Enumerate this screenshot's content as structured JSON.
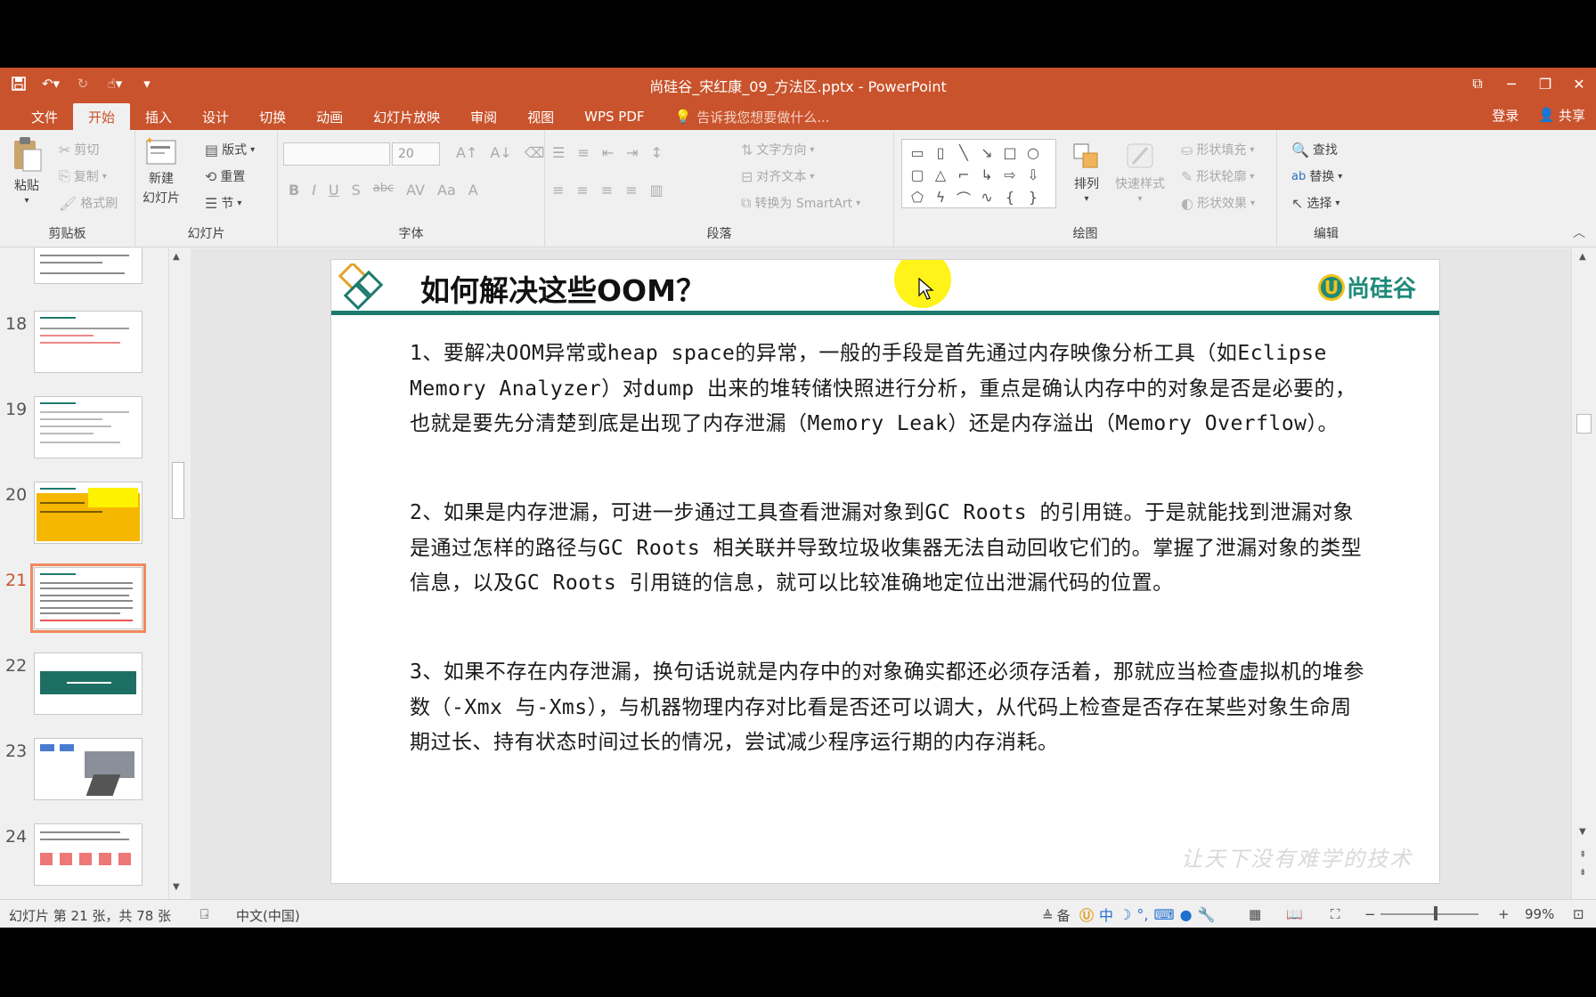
{
  "window": {
    "title": "尚硅谷_宋红康_09_方法区.pptx - PowerPoint",
    "qat_icons": [
      "save-icon",
      "undo-icon",
      "redo-icon",
      "touch-mode-icon",
      "customize-icon"
    ]
  },
  "tabs": [
    {
      "label": "文件"
    },
    {
      "label": "开始"
    },
    {
      "label": "插入"
    },
    {
      "label": "设计"
    },
    {
      "label": "切换"
    },
    {
      "label": "动画"
    },
    {
      "label": "幻灯片放映"
    },
    {
      "label": "审阅"
    },
    {
      "label": "视图"
    },
    {
      "label": "WPS PDF"
    },
    {
      "label": "告诉我您想要做什么..."
    }
  ],
  "tabright": {
    "login": "登录",
    "share": "共享"
  },
  "ribbon": {
    "clipboard": {
      "label": "剪贴板",
      "paste": "粘贴",
      "cut": "剪切",
      "copy": "复制",
      "format_painter": "格式刷"
    },
    "slides": {
      "label": "幻灯片",
      "new_slide": "新建",
      "new_slide2": "幻灯片",
      "layout": "版式",
      "reset": "重置",
      "section": "节"
    },
    "font": {
      "label": "字体",
      "size": "20"
    },
    "paragraph": {
      "label": "段落",
      "text_direction": "文字方向",
      "align_text": "对齐文本",
      "smartart": "转换为 SmartArt"
    },
    "drawing": {
      "label": "绘图",
      "arrange": "排列",
      "quick_styles": "快速样式",
      "shape_fill": "形状填充",
      "shape_outline": "形状轮廓",
      "shape_effects": "形状效果"
    },
    "editing": {
      "label": "编辑",
      "find": "查找",
      "replace": "替换",
      "select": "选择"
    }
  },
  "thumbnails": [
    {
      "num": "18"
    },
    {
      "num": "19"
    },
    {
      "num": "20"
    },
    {
      "num": "21"
    },
    {
      "num": "22"
    },
    {
      "num": "23"
    },
    {
      "num": "24"
    }
  ],
  "slide": {
    "title": "如何解决这些OOM？",
    "brand": "尚硅谷",
    "paragraphs": [
      "1、要解决OOM异常或heap space的异常，一般的手段是首先通过内存映像分析工具（如Eclipse Memory Analyzer）对dump 出来的堆转储快照进行分析，重点是确认内存中的对象是否是必要的，也就是要先分清楚到底是出现了内存泄漏（Memory Leak）还是内存溢出（Memory Overflow）。",
      "2、如果是内存泄漏，可进一步通过工具查看泄漏对象到GC Roots 的引用链。于是就能找到泄漏对象是通过怎样的路径与GC Roots 相关联并导致垃圾收集器无法自动回收它们的。掌握了泄漏对象的类型信息，以及GC Roots 引用链的信息，就可以比较准确地定位出泄漏代码的位置。",
      "3、如果不存在内存泄漏，换句话说就是内存中的对象确实都还必须存活着，那就应当检查虚拟机的堆参数（-Xmx 与-Xms），与机器物理内存对比看是否还可以调大，从代码上检查是否存在某些对象生命周期过长、持有状态时间过长的情况，尝试减少程序运行期的内存消耗。"
    ],
    "watermark": "让天下没有难学的技术"
  },
  "status": {
    "slide_info": "幻灯片 第 21 张，共 78 张",
    "language": "中文(中国)",
    "notes": "备",
    "ime": "中",
    "zoom": "99%"
  }
}
